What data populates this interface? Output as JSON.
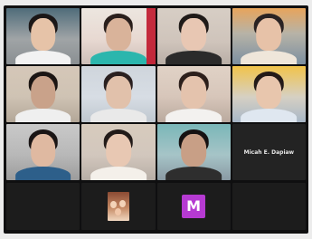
{
  "meeting": {
    "name_only_tile": "Micah E. Dapiaw",
    "avatar_letter": "M"
  }
}
